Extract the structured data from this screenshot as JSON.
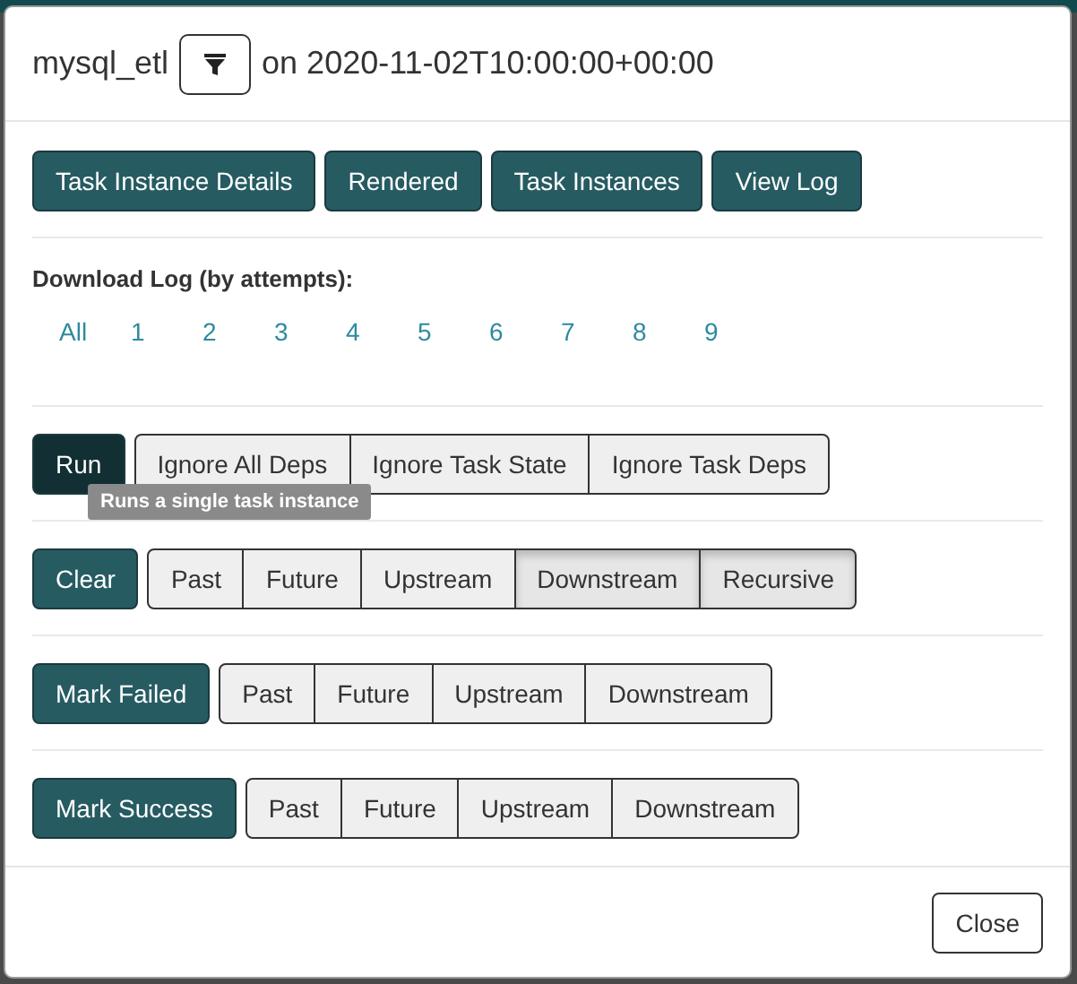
{
  "modal": {
    "title": "mysql_etl",
    "subtitle": "on 2020-11-02T10:00:00+00:00"
  },
  "links": [
    {
      "label": "Task Instance Details"
    },
    {
      "label": "Rendered"
    },
    {
      "label": "Task Instances"
    },
    {
      "label": "View Log"
    }
  ],
  "download": {
    "label": "Download Log (by attempts):",
    "attempts": [
      "All",
      "1",
      "2",
      "3",
      "4",
      "5",
      "6",
      "7",
      "8",
      "9"
    ]
  },
  "actions": [
    {
      "label": "Run",
      "hovered": true,
      "tooltip": "Runs a single task instance",
      "options": [
        {
          "label": "Ignore All Deps",
          "selected": false
        },
        {
          "label": "Ignore Task State",
          "selected": false
        },
        {
          "label": "Ignore Task Deps",
          "selected": false
        }
      ]
    },
    {
      "label": "Clear",
      "hovered": false,
      "options": [
        {
          "label": "Past",
          "selected": false
        },
        {
          "label": "Future",
          "selected": false
        },
        {
          "label": "Upstream",
          "selected": false
        },
        {
          "label": "Downstream",
          "selected": true
        },
        {
          "label": "Recursive",
          "selected": true
        }
      ]
    },
    {
      "label": "Mark Failed",
      "hovered": false,
      "options": [
        {
          "label": "Past",
          "selected": false
        },
        {
          "label": "Future",
          "selected": false
        },
        {
          "label": "Upstream",
          "selected": false
        },
        {
          "label": "Downstream",
          "selected": false
        }
      ]
    },
    {
      "label": "Mark Success",
      "hovered": false,
      "options": [
        {
          "label": "Past",
          "selected": false
        },
        {
          "label": "Future",
          "selected": false
        },
        {
          "label": "Upstream",
          "selected": false
        },
        {
          "label": "Downstream",
          "selected": false
        }
      ]
    }
  ],
  "footer": {
    "close": "Close"
  }
}
